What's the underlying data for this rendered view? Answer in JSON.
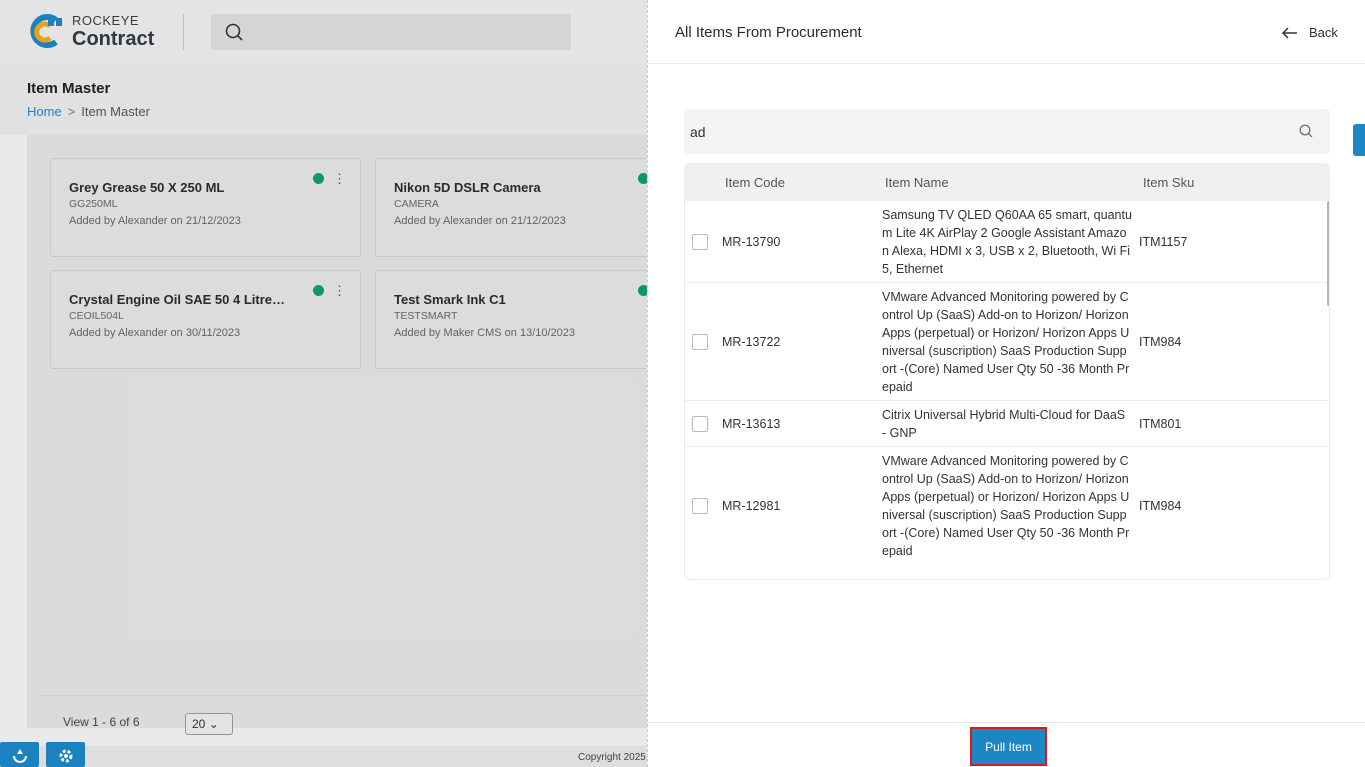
{
  "app": {
    "brand_top": "ROCKEYE",
    "brand_main": "Contract"
  },
  "page": {
    "title": "Item Master",
    "breadcrumb": {
      "home": "Home",
      "sep": ">",
      "current": "Item Master"
    }
  },
  "cards": [
    {
      "title": "Grey Grease 50 X 250 ML",
      "code": "GG250ML",
      "added_by_label": "Added by",
      "user": "Alexander",
      "on_label": "on",
      "date": "21/12/2023"
    },
    {
      "title": "Nikon 5D DSLR Camera",
      "code": "CAMERA",
      "added_by_label": "Added by",
      "user": "Alexander",
      "on_label": "on",
      "date": "21/12/2023"
    },
    {
      "title": "Crystal Engine Oil SAE 50 4 Litres ...",
      "code": "CEOIL504L",
      "added_by_label": "Added by",
      "user": "Alexander",
      "on_label": "on",
      "date": "30/11/2023"
    },
    {
      "title": "Test Smark Ink C1",
      "code": "TESTSMART",
      "added_by_label": "Added by",
      "user": "Maker CMS",
      "on_label": "on",
      "date": "13/10/2023"
    }
  ],
  "pager": {
    "text": "View 1 - 6 of 6",
    "page_size": "20"
  },
  "footer": {
    "copyright": "Copyright 2025"
  },
  "drawer": {
    "title": "All Items From Procurement",
    "back_label": "Back",
    "search_value": "ad",
    "columns": {
      "code": "Item Code",
      "name": "Item Name",
      "sku": "Item Sku"
    },
    "rows": [
      {
        "code": "MR-13790",
        "name": "Samsung TV QLED Q60AA 65 smart, quantum Lite 4K AirPlay 2 Google Assistant Amazon Alexa, HDMI x 3, USB x 2, Bluetooth, Wi Fi 5, Ethernet",
        "sku": "ITM1157"
      },
      {
        "code": "MR-13722",
        "name": "VMware Advanced Monitoring powered by Control Up (SaaS) Add-on to Horizon/ Horizon Apps (perpetual) or Horizon/ Horizon Apps Universal (suscription) SaaS Production Support -(Core) Named User Qty 50 -36 Month Prepaid",
        "sku": "ITM984"
      },
      {
        "code": "MR-13613",
        "name": "Citrix Universal Hybrid Multi-Cloud for DaaS - GNP",
        "sku": "ITM801"
      },
      {
        "code": "MR-12981",
        "name": "VMware Advanced Monitoring powered by Control Up (SaaS) Add-on to Horizon/ Horizon Apps (perpetual) or Horizon/ Horizon Apps Universal (suscription) SaaS Production Support -(Core) Named User Qty 50 -36 Month Prepaid",
        "sku": "ITM984"
      }
    ],
    "pull_label": "Pull Item"
  },
  "colors": {
    "accent": "#1d87c6",
    "status_green": "#0f9b73",
    "highlight": "#d71c1c"
  }
}
